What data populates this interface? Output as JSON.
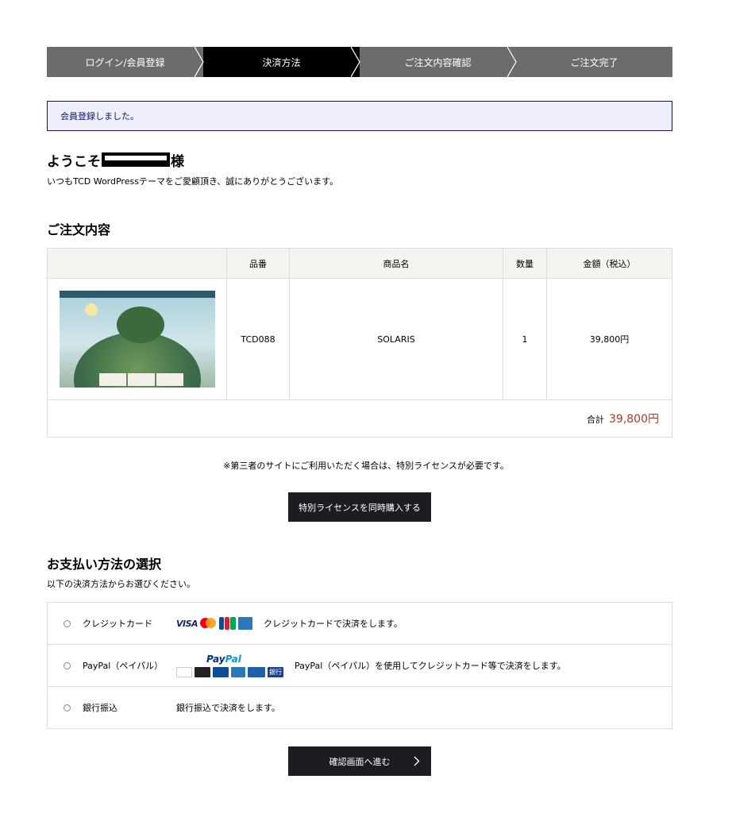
{
  "steps": [
    {
      "label": "ログイン/会員登録"
    },
    {
      "label": "決済方法"
    },
    {
      "label": "ご注文内容確認"
    },
    {
      "label": "ご注文完了"
    }
  ],
  "notice": "会員登録しました。",
  "welcome": {
    "prefix": "ようこそ",
    "suffix": "様",
    "sub": "いつもTCD WordPressテーマをご愛顧頂き、誠にありがとうございます。"
  },
  "order": {
    "title": "ご注文内容",
    "headers": {
      "image": "",
      "code": "品番",
      "name": "商品名",
      "qty": "数量",
      "price": "金額（税込）"
    },
    "item": {
      "code": "TCD088",
      "name": "SOLARIS",
      "qty": "1",
      "price": "39,800円"
    },
    "total_label": "合計",
    "total_value": "39,800円"
  },
  "license": {
    "note": "※第三者のサイトにご利用いただく場合は、特別ライセンスが必要です。",
    "button": "特別ライセンスを同時購入する"
  },
  "payment": {
    "title": "お支払い方法の選択",
    "sub": "以下の決済方法からお選びください。",
    "methods": [
      {
        "label": "クレジットカード",
        "desc": "クレジットカードで決済をします。"
      },
      {
        "label": "PayPal（ペイパル）",
        "desc": "PayPal（ペイパル）を使用してクレジットカード等で決済をします。",
        "logo_a": "Pay",
        "logo_b": "Pal"
      },
      {
        "label": "銀行振込",
        "desc": "銀行振込で決済をします。"
      }
    ],
    "card_brand": "VISA",
    "bank_badge": "銀行"
  },
  "confirm_button": "確認画面へ進む",
  "colors": {
    "step_active": "#000000",
    "step_inactive": "#6b6c6d",
    "notice_border": "#0e1470",
    "total": "#b8372b",
    "button": "#1c1d20"
  }
}
